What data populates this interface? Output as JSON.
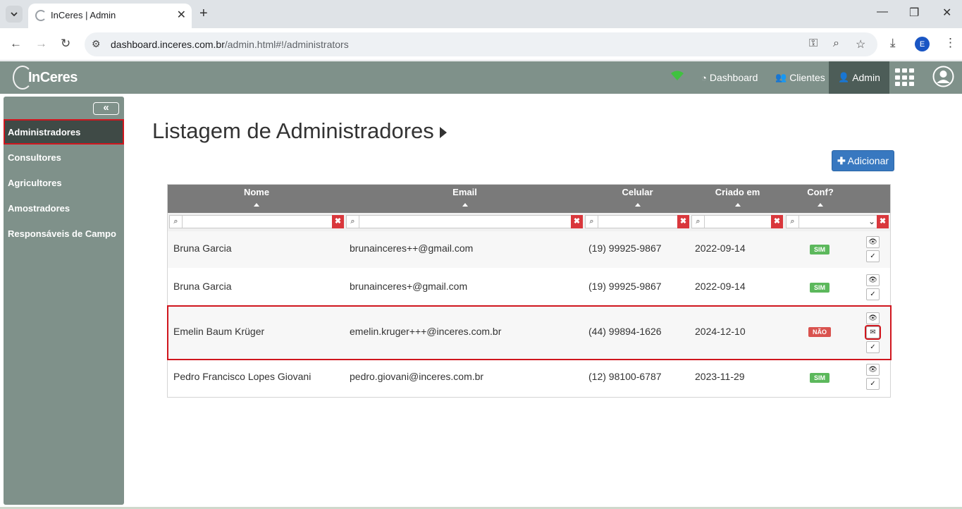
{
  "browser": {
    "tab_title": "InCeres | Admin",
    "url_host": "dashboard.inceres.com.br",
    "url_path": "/admin.html#!/administrators",
    "profile_initial": "E"
  },
  "navbar": {
    "logo_text": "InCeres",
    "links": [
      {
        "label": "Dashboard",
        "icon": "dashboard-icon"
      },
      {
        "label": "Clientes",
        "icon": "users-icon"
      },
      {
        "label": "Admin",
        "icon": "user-plus-icon"
      }
    ]
  },
  "sidebar": {
    "items": [
      {
        "label": "Administradores"
      },
      {
        "label": "Consultores"
      },
      {
        "label": "Agricultores"
      },
      {
        "label": "Amostradores"
      },
      {
        "label": "Responsáveis de Campo"
      }
    ]
  },
  "main": {
    "title": "Listagem de Administradores",
    "add_button": "Adicionar"
  },
  "table": {
    "headers": [
      "Nome",
      "Email",
      "Celular",
      "Criado em",
      "Conf?"
    ],
    "rows": [
      {
        "nome": "Bruna Garcia",
        "email": "brunainceres++@gmail.com",
        "celular": "(19) 99925-9867",
        "criado": "2022-09-14",
        "conf": "SIM"
      },
      {
        "nome": "Bruna Garcia",
        "email": "brunainceres+@gmail.com",
        "celular": "(19) 99925-9867",
        "criado": "2022-09-14",
        "conf": "SIM"
      },
      {
        "nome": "Emelin Baum Krüger",
        "email": "emelin.kruger+++@inceres.com.br",
        "celular": "(44) 99894-1626",
        "criado": "2024-12-10",
        "conf": "NÃO"
      },
      {
        "nome": "Pedro Francisco Lopes Giovani",
        "email": "pedro.giovani@inceres.com.br",
        "celular": "(12) 98100-6787",
        "criado": "2023-11-29",
        "conf": "SIM"
      }
    ]
  },
  "colors": {
    "navbar": "#7f918a",
    "sidebar_active": "#3f4a46",
    "add_button": "#3878c0",
    "badge_sim": "#5cb85c",
    "badge_nao": "#d9534f",
    "highlight": "#d0161e"
  }
}
